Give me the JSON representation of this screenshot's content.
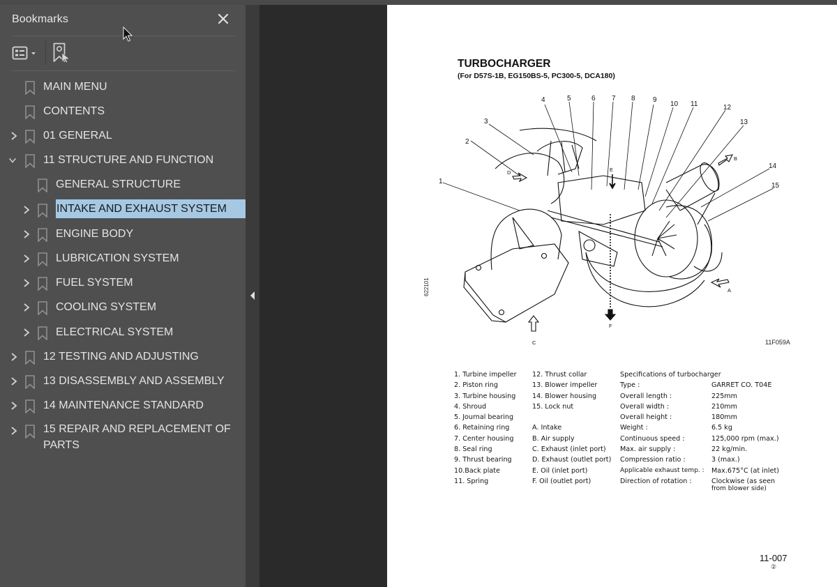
{
  "sidebar": {
    "title": "Bookmarks",
    "close_icon": "close-icon",
    "tools": {
      "view_options": "bookmark-options-icon",
      "find_current": "find-current-bookmark-icon"
    },
    "bookmarks": [
      {
        "label": "MAIN MENU",
        "level": 0,
        "expander": "none"
      },
      {
        "label": "CONTENTS",
        "level": 0,
        "expander": "none"
      },
      {
        "label": "01 GENERAL",
        "level": 0,
        "expander": "collapsed"
      },
      {
        "label": "11 STRUCTURE AND FUNCTION",
        "level": 0,
        "expander": "expanded"
      },
      {
        "label": "GENERAL STRUCTURE",
        "level": 1,
        "expander": "none"
      },
      {
        "label": "INTAKE AND EXHAUST SYSTEM",
        "level": 1,
        "expander": "collapsed",
        "selected": true
      },
      {
        "label": "ENGINE BODY",
        "level": 1,
        "expander": "collapsed"
      },
      {
        "label": "LUBRICATION SYSTEM",
        "level": 1,
        "expander": "collapsed"
      },
      {
        "label": "FUEL SYSTEM",
        "level": 1,
        "expander": "collapsed"
      },
      {
        "label": "COOLING SYSTEM",
        "level": 1,
        "expander": "collapsed"
      },
      {
        "label": "ELECTRICAL SYSTEM",
        "level": 1,
        "expander": "collapsed"
      },
      {
        "label": "12 TESTING AND ADJUSTING",
        "level": 0,
        "expander": "collapsed"
      },
      {
        "label": "13 DISASSEMBLY AND ASSEMBLY",
        "level": 0,
        "expander": "collapsed"
      },
      {
        "label": "14 MAINTENANCE STANDARD",
        "level": 0,
        "expander": "collapsed"
      },
      {
        "label": "15 REPAIR AND REPLACEMENT OF PARTS",
        "level": 0,
        "expander": "collapsed"
      }
    ]
  },
  "page": {
    "title": "TURBOCHARGER",
    "subtitle": "(For D57S-1B, EG150BS-5, PC300-5, DCA180)",
    "figure_code": "11F059A",
    "side_code": "622101",
    "callouts": [
      "1",
      "2",
      "3",
      "4",
      "5",
      "6",
      "7",
      "8",
      "9",
      "10",
      "11",
      "12",
      "13",
      "14",
      "15"
    ],
    "flow_labels": {
      "A": "A",
      "B": "B",
      "C": "C",
      "D": "D",
      "E": "E",
      "F": "F"
    },
    "parts_col1": [
      "1. Turbine impeller",
      "2. Piston ring",
      "3. Turbine housing",
      "4. Shroud",
      "5. Journal bearing",
      "6. Retaining ring",
      "7. Center housing",
      "8. Seal ring",
      "9. Thrust bearing",
      "10.Back plate",
      "11. Spring"
    ],
    "parts_col2": [
      "12. Thrust collar",
      "13. Blower impeller",
      "14. Blower housing",
      "15. Lock nut",
      "",
      "A. Intake",
      "B. Air supply",
      "C. Exhaust (inlet port)",
      "D. Exhaust (outlet port)",
      "E. Oil (inlet port)",
      "F. Oil (outlet port)"
    ],
    "specs": {
      "heading": "Specifications of turbocharger",
      "rows": [
        {
          "k": "Type :",
          "v": "GARRET CO. T04E"
        },
        {
          "k": "Overall length :",
          "v": "225mm"
        },
        {
          "k": "Overall width :",
          "v": "210mm"
        },
        {
          "k": "Overall height :",
          "v": "180mm"
        },
        {
          "k": "Weight :",
          "v": "6.5 kg"
        },
        {
          "k": "Continuous speed :",
          "v": "125,000 rpm (max.)"
        },
        {
          "k": "Max. air supply :",
          "v": "22 kg/min."
        },
        {
          "k": "Compression ratio :",
          "v": "3 (max.)"
        },
        {
          "k": "Applicable exhaust temp. :",
          "v": "Max.675°C (at inlet)"
        },
        {
          "k": "Direction of rotation :",
          "v": "Clockwise (as seen",
          "v2": "from blower side)"
        }
      ]
    },
    "page_number": "11-007",
    "revision": "②"
  }
}
